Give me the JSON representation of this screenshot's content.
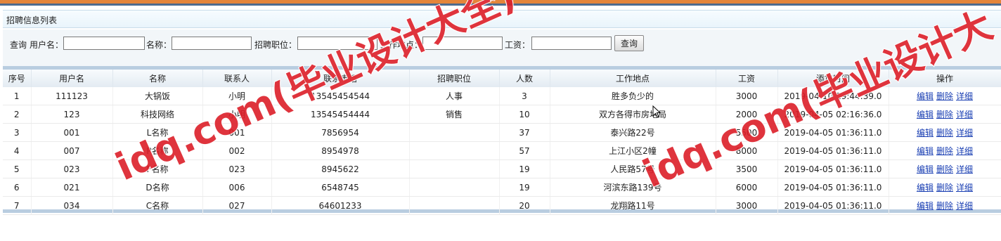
{
  "colors": {
    "accent": "#e4853a",
    "header_band": "#4e6b8f",
    "link": "#1a3fb3",
    "watermark": "#dc1e28"
  },
  "page": {
    "title": "招聘信息列表"
  },
  "search": {
    "query_label": "查询",
    "username_label": "用户名：",
    "name_label": "名称：",
    "position_label": "招聘职位：",
    "location_label": "工作地点：",
    "salary_label": "工资：",
    "username_value": "",
    "name_value": "",
    "position_value": "",
    "location_value": "",
    "salary_value": "",
    "button_label": "查询"
  },
  "table": {
    "headers": [
      "序号",
      "用户名",
      "名称",
      "联系人",
      "联系电话",
      "招聘职位",
      "人数",
      "工作地点",
      "工资",
      "添加时间",
      "操作"
    ],
    "rows": [
      [
        "1",
        "111123",
        "大锅饭",
        "小明",
        "13545454544",
        "人事",
        "3",
        "胜多负少的",
        "3000",
        "2019-04-10 19:44:39.0"
      ],
      [
        "2",
        "123",
        "科技网络",
        "小明",
        "13545454444",
        "销售",
        "10",
        "双方各得市房地局",
        "2000",
        "2019-04-05 02:16:36.0"
      ],
      [
        "3",
        "001",
        "L名称",
        "001",
        "7856954",
        "",
        "37",
        "泰兴路22号",
        "5500",
        "2019-04-05 01:36:11.0"
      ],
      [
        "4",
        "007",
        "P名称",
        "002",
        "8954978",
        "",
        "57",
        "上江小区2幢",
        "8000",
        "2019-04-05 01:36:11.0"
      ],
      [
        "5",
        "023",
        "F名称",
        "023",
        "8945622",
        "",
        "19",
        "人民路57号",
        "3500",
        "2019-04-05 01:36:11.0"
      ],
      [
        "6",
        "021",
        "D名称",
        "006",
        "6548745",
        "",
        "19",
        "河滨东路139号",
        "6000",
        "2019-04-05 01:36:11.0"
      ],
      [
        "7",
        "034",
        "C名称",
        "027",
        "64601233",
        "",
        "20",
        "龙翔路11号",
        "3000",
        "2019-04-05 01:36:11.0"
      ]
    ],
    "actions": [
      "编辑",
      "删除",
      "详细"
    ]
  },
  "watermark": {
    "text1": "idq.com(毕业设计大全)",
    "text2": "idq.com(毕业设计大"
  }
}
